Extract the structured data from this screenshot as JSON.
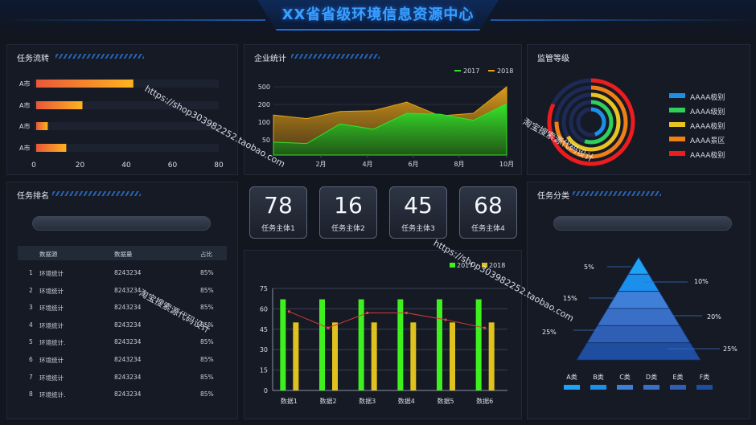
{
  "header": {
    "title": "XX省省级环境信息资源中心"
  },
  "panels": {
    "task_flow": "任务流转",
    "enterprise_stats": "企业统计",
    "supervision_level": "监管等级",
    "task_rank": "任务排名",
    "task_category": "任务分类"
  },
  "hbar_chart": {
    "categories": [
      "A市",
      "A市",
      "A市",
      "A市"
    ],
    "values": [
      42,
      20,
      5,
      13
    ],
    "xlim": [
      0,
      80
    ],
    "ticks": [
      "0",
      "20",
      "40",
      "60",
      "80"
    ],
    "tick_values": [
      0,
      20,
      40,
      60,
      80
    ]
  },
  "area_chart": {
    "type": "area",
    "series": [
      {
        "name": "2017",
        "color": "#35e02a",
        "values": [
          45,
          42,
          95,
          80,
          150,
          145,
          110,
          215
        ]
      },
      {
        "name": "2018",
        "color": "#e3a21a",
        "values": [
          140,
          120,
          160,
          165,
          240,
          135,
          150,
          510
        ]
      }
    ],
    "x": [
      0,
      1,
      2,
      3,
      4,
      5,
      6,
      7
    ],
    "xticks": [
      "2月",
      "4月",
      "6月",
      "8月",
      "10月"
    ],
    "yticks": [
      "500",
      "200",
      "100",
      "50"
    ]
  },
  "stats": [
    {
      "value": "78",
      "label": "任务主体1"
    },
    {
      "value": "16",
      "label": "任务主体2"
    },
    {
      "value": "45",
      "label": "任务主体3"
    },
    {
      "value": "68",
      "label": "任务主体4"
    }
  ],
  "rings_legend": [
    {
      "label": "AAAA极别",
      "color": "#1e8fe6"
    },
    {
      "label": "AAAA级别",
      "color": "#2fcf5a"
    },
    {
      "label": "AAAA极别",
      "color": "#e8c420"
    },
    {
      "label": "AAAA景区",
      "color": "#f07f15"
    },
    {
      "label": "AAAA极别",
      "color": "#ee1c1c"
    }
  ],
  "rings_data": [
    0.82,
    0.75,
    0.66,
    0.55,
    0.45
  ],
  "table": {
    "headers": [
      "数据源",
      "数据量",
      "占比"
    ],
    "rows": [
      {
        "n": "1",
        "name": "环境统计",
        "qty": "8243234",
        "pct": "85%"
      },
      {
        "n": "2",
        "name": "环境统计",
        "qty": "8243234",
        "pct": "85%"
      },
      {
        "n": "3",
        "name": "环境统计",
        "qty": "8243234",
        "pct": "85%"
      },
      {
        "n": "4",
        "name": "环境统计",
        "qty": "8243234",
        "pct": "85%"
      },
      {
        "n": "5",
        "name": "环境统计.",
        "qty": "8243234",
        "pct": "85%"
      },
      {
        "n": "6",
        "name": "环境统计",
        "qty": "8243234",
        "pct": "85%"
      },
      {
        "n": "7",
        "name": "环境统计",
        "qty": "8243234",
        "pct": "85%"
      },
      {
        "n": "8",
        "name": "环境统计.",
        "qty": "8243234",
        "pct": "85%"
      }
    ]
  },
  "bar_chart": {
    "type": "bar",
    "categories": [
      "数据1",
      "数据2",
      "数据3",
      "数据4",
      "数据5",
      "数据6"
    ],
    "series": [
      {
        "name": "2017",
        "color": "#3ef01e",
        "values": [
          67,
          67,
          67,
          67,
          67,
          67
        ]
      },
      {
        "name": "2018",
        "color": "#e0c21e",
        "values": [
          50,
          50,
          50,
          50,
          50,
          50
        ]
      }
    ],
    "line_values": [
      58,
      46,
      57,
      57,
      52,
      46
    ],
    "yticks": [
      "0",
      "15",
      "30",
      "45",
      "60",
      "75"
    ],
    "ylim": [
      0,
      75
    ]
  },
  "pyramid": {
    "labels": [
      "5%",
      "10%",
      "15%",
      "20%",
      "25%",
      "25%"
    ],
    "categories": [
      "A类",
      "B类",
      "C类",
      "D类",
      "E类",
      "F类"
    ],
    "colors": [
      "#1fa3f5",
      "#1a8fec",
      "#3f7fd8",
      "#3a6fc8",
      "#2f5fb5",
      "#1f4ea0"
    ]
  },
  "watermarks": {
    "url1": "https://shop303982252.taobao.com",
    "cn1": "淘宝搜索源代码设计",
    "url2": "https://shop303982252.taobao.com",
    "cn2": "淘宝搜索源代码设计"
  }
}
